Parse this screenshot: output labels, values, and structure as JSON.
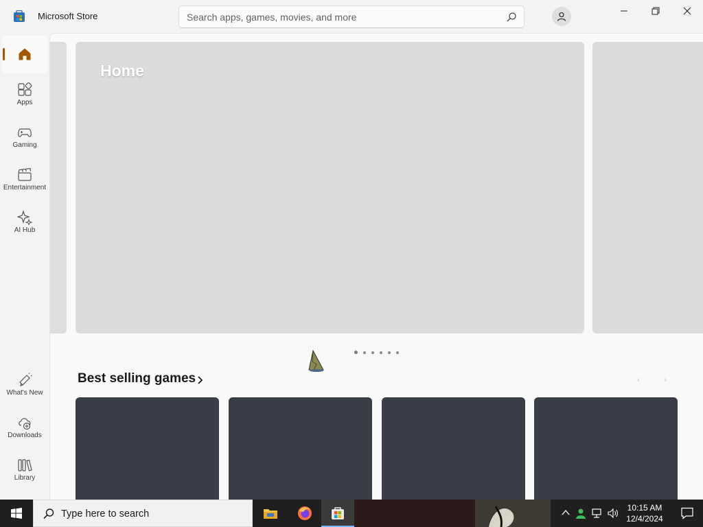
{
  "window": {
    "title": "Microsoft Store",
    "search_placeholder": "Search apps, games, movies, and more"
  },
  "sidebar": {
    "items": [
      {
        "label": "",
        "icon": "home-icon",
        "active": true
      },
      {
        "label": "Apps",
        "icon": "apps-icon"
      },
      {
        "label": "Gaming",
        "icon": "gamepad-icon"
      },
      {
        "label": "Entertainment",
        "icon": "clapperboard-icon"
      },
      {
        "label": "AI Hub",
        "icon": "sparkle-icon"
      }
    ],
    "bottom_items": [
      {
        "label": "What's New",
        "icon": "megaphone-icon"
      },
      {
        "label": "Downloads",
        "icon": "cloud-download-icon"
      },
      {
        "label": "Library",
        "icon": "library-icon"
      }
    ]
  },
  "hero": {
    "title": "Home",
    "slide_count": 6,
    "active_slide": 1
  },
  "section": {
    "title": "Best selling games"
  },
  "taskbar": {
    "search_placeholder": "Type here to search",
    "time": "10:15 AM",
    "date": "12/4/2024"
  },
  "colors": {
    "accent": "#a55800",
    "card": "#393d46",
    "taskbar": "#1f1f1f"
  }
}
